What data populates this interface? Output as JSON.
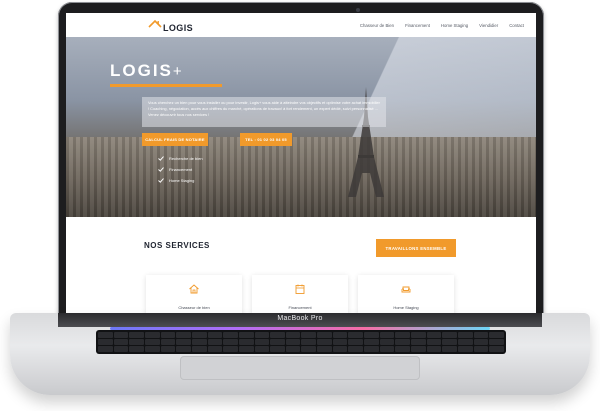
{
  "device": {
    "model_label": "MacBook Pro"
  },
  "nav": {
    "logo_text": "LOGIS",
    "links": [
      "Chasseur de Bien",
      "Financement",
      "Home Staging",
      "Viendidier",
      "Contact"
    ]
  },
  "hero": {
    "title": "LOGIS",
    "title_suffix": "+",
    "description": "Vous cherchez un bien pour vous installer ou pour investir, Logis+ vous aide à atteindre vos objectifs et optimise votre achat immobilier ! Coaching, négociation, accès aux chiffres du marché, opérations de travaux! à fort rendement, un expert dédié, suivi personnalisé ... Venez découvrir tous nos services !",
    "buttons": {
      "calc": "CALCUL FRAIS DE NOTAIRE",
      "tel": "TEL : 01 02 03 04 05"
    },
    "checklist": [
      "Recherche de bien",
      "Financement",
      "Home Staging"
    ]
  },
  "services": {
    "title": "NOS SERVICES",
    "cta": "TRAVAILLONS ENSEMBLE",
    "cards": [
      "Chasseur de bien",
      "Financement",
      "Home Staging"
    ]
  },
  "colors": {
    "accent": "#f19a2b",
    "dark": "#1f2430"
  },
  "icons": [
    "house-roof-icon",
    "check-icon",
    "home-icon",
    "calendar-icon",
    "sofa-icon",
    "eiffel-tower"
  ]
}
